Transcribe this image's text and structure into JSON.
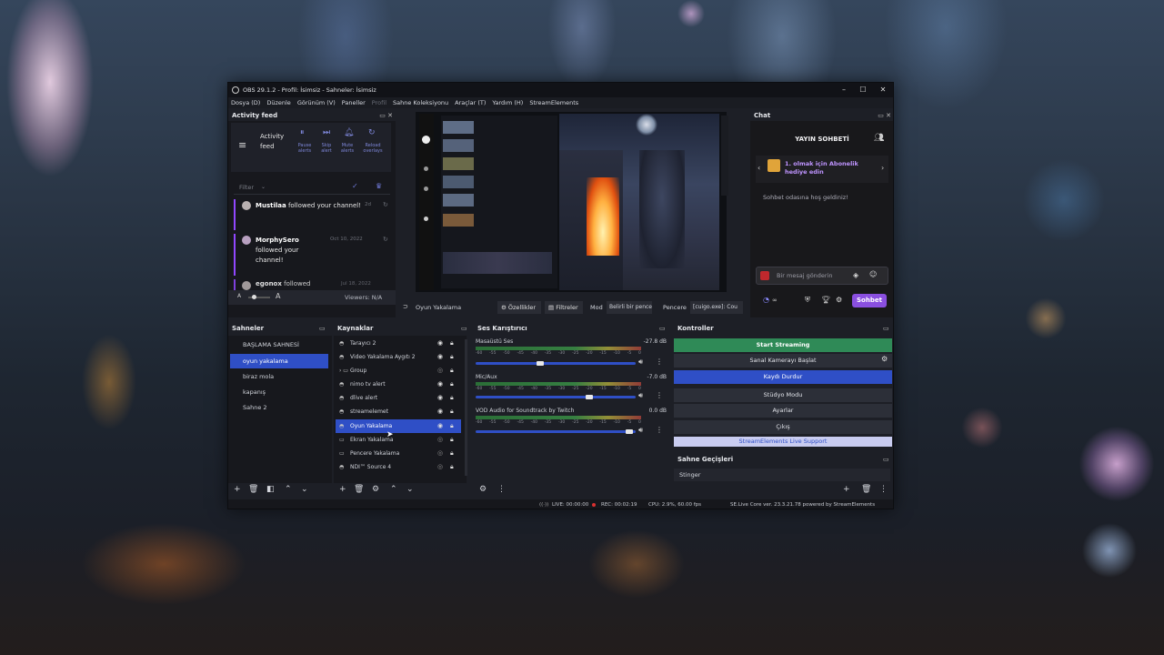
{
  "window": {
    "title": "OBS 29.1.2 - Profil: İsimsiz - Sahneler: İsimsiz",
    "controls": [
      "–",
      "☐",
      "✕"
    ]
  },
  "menubar": [
    "Dosya (D)",
    "Düzenle",
    "Görünüm (V)",
    "Paneller",
    "Profil",
    "Sahne Koleksiyonu",
    "Araçlar (T)",
    "Yardım (H)",
    "StreamElements"
  ],
  "activity_feed": {
    "title": "Activity feed",
    "header_label": "Activity feed",
    "actions": [
      "Pause alerts",
      "Skip alert",
      "Mute alerts",
      "Reload overlays"
    ],
    "filter_label": "Filter",
    "events": [
      {
        "name": "Mustilaa",
        "text": "followed your channel!",
        "time": "2d"
      },
      {
        "name": "MorphySero",
        "text": "followed your channel!",
        "time": "Oct 10, 2022"
      },
      {
        "name": "egonox",
        "text": "followed",
        "time": "Jul 18, 2022"
      }
    ],
    "font_a_small": "A",
    "font_a_large": "A",
    "viewers": "Viewers: N/A"
  },
  "preview_toolbar": {
    "source_name": "Oyun Yakalama",
    "properties": "Özellikler",
    "filters": "Filtreler",
    "mode_label": "Mod",
    "mode_value": "Belirli bir pence",
    "window_label": "Pencere",
    "window_value": "[cuigo.exe]: Cou"
  },
  "chat": {
    "title": "Chat",
    "header": "YAYIN SOHBETİ",
    "promo": "1. olmak için Abonelik hediye edin",
    "welcome": "Sohbet odasına hoş geldiniz!",
    "placeholder": "Bir mesaj gönderin",
    "button": "Sohbet",
    "points": "∞"
  },
  "scenes": {
    "title": "Sahneler",
    "items": [
      "BAŞLAMA SAHNESİ",
      "oyun yakalama",
      "biraz mola",
      "kapanış",
      "Sahne 2"
    ],
    "selected_index": 1
  },
  "sources": {
    "title": "Kaynaklar",
    "items": [
      "Tarayıcı 2",
      "Video Yakalama Aygıtı 2",
      "Group",
      "nimo tv alert",
      "dlive alert",
      "streamelemet",
      "Oyun Yakalama",
      "Ekran Yakalama",
      "Pencere Yakalama",
      "NDI™ Source 4"
    ],
    "selected_index": 6
  },
  "mixer": {
    "title": "Ses Karıştırıcı",
    "channels": [
      {
        "name": "Masaüstü Ses",
        "db": "-27.8 dB",
        "volume": 0.4
      },
      {
        "name": "Mic/Aux",
        "db": "-7.0 dB",
        "volume": 0.72
      },
      {
        "name": "VOD Audio for Soundtrack by Twitch",
        "db": "0.0 dB",
        "volume": 0.98
      }
    ],
    "scale": [
      "-60",
      "-55",
      "-50",
      "-45",
      "-40",
      "-35",
      "-30",
      "-25",
      "-20",
      "-15",
      "-10",
      "-5",
      "0"
    ]
  },
  "controls": {
    "title": "Kontroller",
    "start_streaming": "Start Streaming",
    "virtual_cam": "Sanal Kamerayı Başlat",
    "stop_recording": "Kaydı Durdur",
    "studio_mode": "Stüdyo Modu",
    "settings": "Ayarlar",
    "exit": "Çıkış",
    "se_support": "StreamElements Live Support"
  },
  "transitions": {
    "title": "Sahne Geçişleri",
    "value": "Stinger"
  },
  "status": {
    "live": "LIVE: 00:00:00",
    "rec": "REC: 00:02:19",
    "cpu": "CPU: 2.9%, 60.00 fps",
    "se": "SE.Live Core ver. 23.3.21.78 powered by StreamElements"
  },
  "colors": {
    "accent_blue": "#2f4fc6",
    "stream_green": "#2f8a57",
    "chat_purple": "#8a4fe0",
    "feed_purple": "#9147ff"
  }
}
